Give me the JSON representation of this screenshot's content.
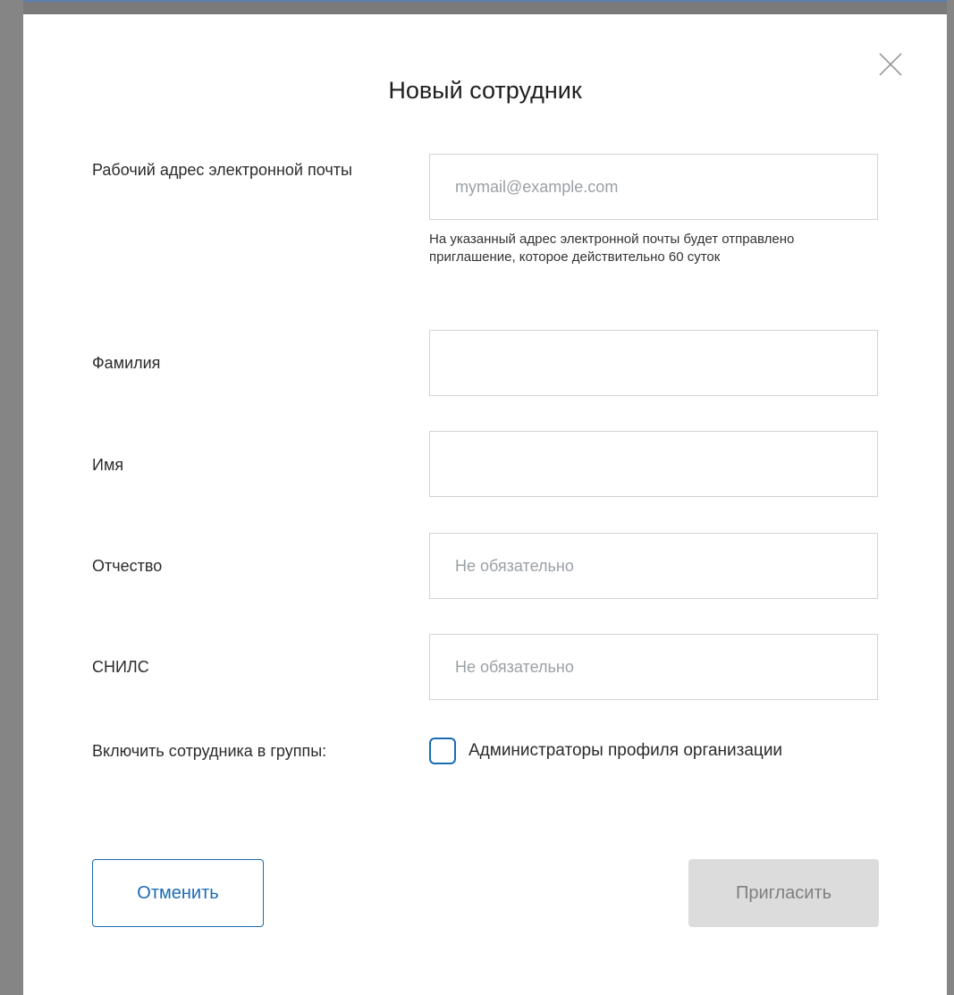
{
  "dialog": {
    "title": "Новый сотрудник",
    "close_icon": "close-icon"
  },
  "form": {
    "email": {
      "label": "Рабочий адрес электронной почты",
      "placeholder": "mymail@example.com",
      "value": "",
      "hint": "На указанный адрес электронной почты будет отправлено приглашение, которое действительно 60 суток"
    },
    "last_name": {
      "label": "Фамилия",
      "placeholder": "",
      "value": ""
    },
    "first_name": {
      "label": "Имя",
      "placeholder": "",
      "value": ""
    },
    "middle_name": {
      "label": "Отчество",
      "placeholder": "Не обязательно",
      "value": ""
    },
    "snils": {
      "label": "СНИЛС",
      "placeholder": "Не обязательно",
      "value": ""
    },
    "groups": {
      "label": "Включить сотрудника в группы:",
      "options": [
        {
          "label": "Администраторы профиля организации",
          "checked": false
        }
      ]
    }
  },
  "buttons": {
    "cancel_label": "Отменить",
    "invite_label": "Пригласить"
  },
  "colors": {
    "accent": "#1a6bb5",
    "disabled_button_bg": "#dcdcdc",
    "disabled_button_text": "#7f7f7f"
  }
}
